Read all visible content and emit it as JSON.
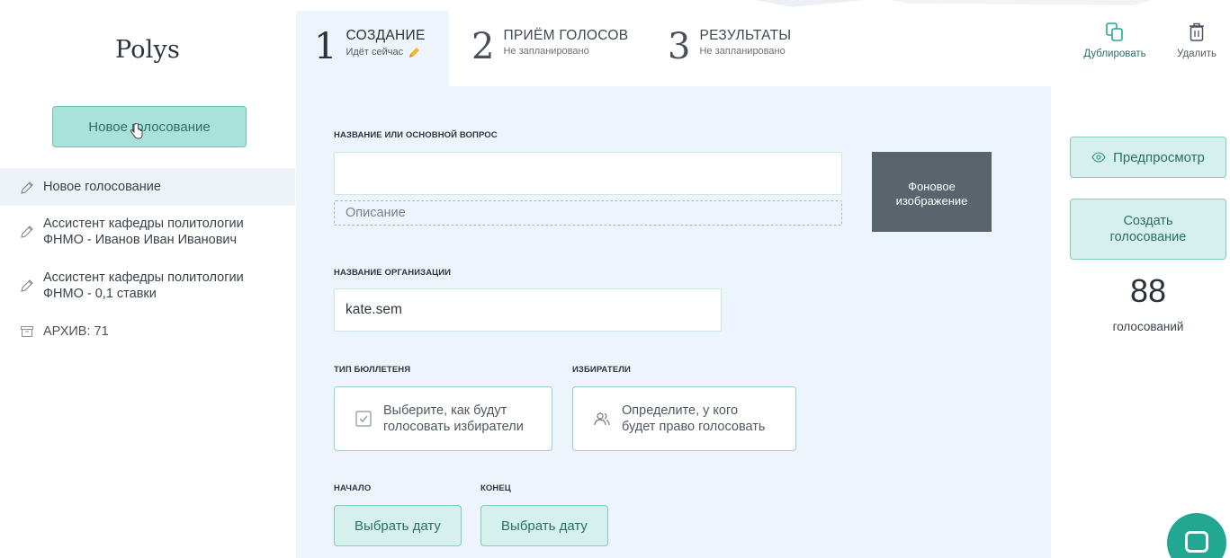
{
  "app": {
    "logo": "Polys"
  },
  "sidebar": {
    "new_poll_button": "Новое голосование",
    "items": [
      {
        "label": "Новое голосование",
        "icon": "pencil-icon"
      },
      {
        "label": "Ассистент кафедры политологии\nФНМО - Иванов Иван Иванович",
        "icon": "pencil-icon"
      },
      {
        "label": "Ассистент кафедры политологии\nФНМО - 0,1 ставки",
        "icon": "pencil-icon"
      },
      {
        "label": "АРХИВ: 71",
        "icon": "archive-icon"
      }
    ]
  },
  "tabs": [
    {
      "number": "1",
      "title": "СОЗДАНИЕ",
      "subtitle": "Идёт сейчас"
    },
    {
      "number": "2",
      "title": "ПРИЁМ ГОЛОСОВ",
      "subtitle": "Не запланировано"
    },
    {
      "number": "3",
      "title": "РЕЗУЛЬТАТЫ",
      "subtitle": "Не запланировано"
    }
  ],
  "form": {
    "title_label": "НАЗВАНИЕ ИЛИ ОСНОВНОЙ ВОПРОС",
    "title_value": "",
    "description_placeholder": "Описание",
    "background_image_button": "Фоновое\nизображение",
    "org_label": "НАЗВАНИЕ ОРГАНИЗАЦИИ",
    "org_value": "kate.sem",
    "ballot_type_label": "ТИП БЮЛЛЕТЕНЯ",
    "ballot_type_text": "Выберите, как будут\nголосовать избиратели",
    "voters_label": "ИЗБИРАТЕЛИ",
    "voters_text": "Определите, у кого\nбудет право голосовать",
    "start_label": "НАЧАЛО",
    "end_label": "КОНЕЦ",
    "start_date_button": "Выбрать дату",
    "end_date_button": "Выбрать дату"
  },
  "actions": {
    "duplicate": "Дублировать",
    "delete": "Удалить",
    "preview": "Предпросмотр",
    "create_poll": "Создать\nголосование",
    "poll_count": "88",
    "poll_count_label": "голосований"
  },
  "colors": {
    "accent": "#22a892",
    "button_fill": "#d6f1ed",
    "button_border": "#7ecbbf",
    "panel": "#eef4fb",
    "dark_tile": "#5a646c"
  }
}
